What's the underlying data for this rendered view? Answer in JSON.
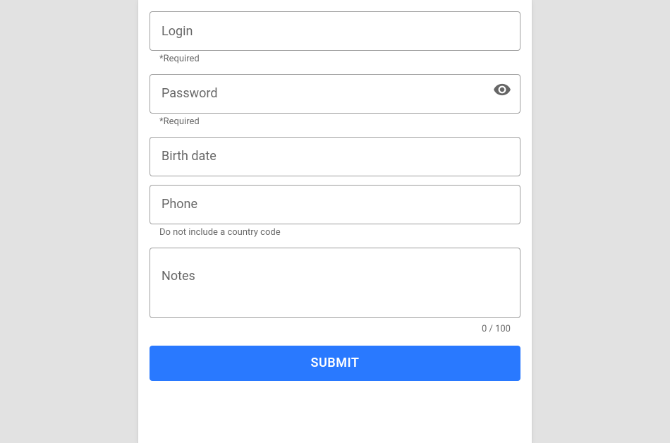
{
  "form": {
    "login": {
      "placeholder": "Login",
      "value": "",
      "helper": "*Required"
    },
    "password": {
      "placeholder": "Password",
      "value": "",
      "helper": "*Required"
    },
    "birth": {
      "placeholder": "Birth date",
      "value": ""
    },
    "phone": {
      "placeholder": "Phone",
      "value": "",
      "helper": "Do not include a country code"
    },
    "notes": {
      "placeholder": "Notes",
      "value": "",
      "counter": "0 / 100"
    },
    "submit_label": "SUBMIT"
  },
  "colors": {
    "primary": "#2979ff"
  }
}
